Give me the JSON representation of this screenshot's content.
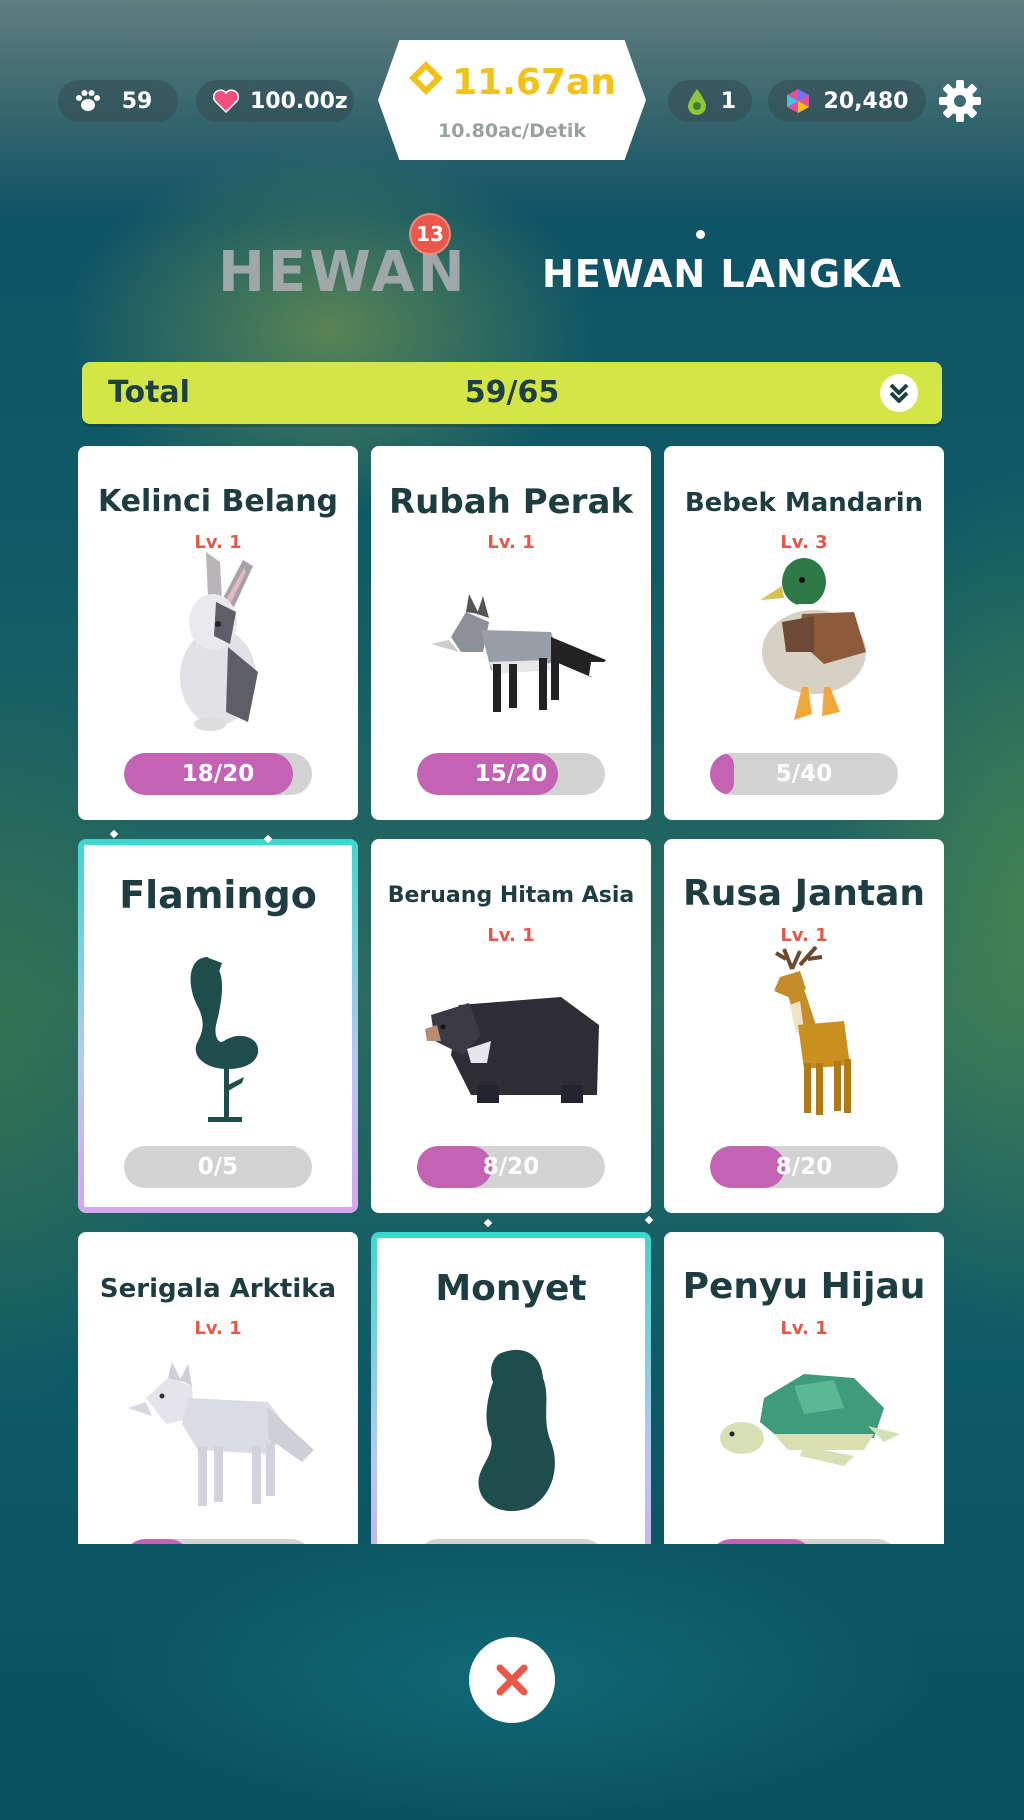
{
  "topbar": {
    "paws": "59",
    "hearts": "100.00z",
    "money": "11.67an",
    "rate": "10.80ac/Detik",
    "drops": "1",
    "gems": "20,480"
  },
  "tabs": {
    "hewan": "HEWAN",
    "hewan_badge": "13",
    "langka": "HEWAN LANGKA"
  },
  "total": {
    "label": "Total",
    "value": "59/65"
  },
  "cards": [
    {
      "name": "Kelinci Belang",
      "level": "Lv. 1",
      "progress": "18/20",
      "fraction": 0.9
    },
    {
      "name": "Rubah Perak",
      "level": "Lv. 1",
      "progress": "15/20",
      "fraction": 0.75
    },
    {
      "name": "Bebek Mandarin",
      "level": "Lv. 3",
      "progress": "5/40",
      "fraction": 0.125
    },
    {
      "name": "Flamingo",
      "level": "",
      "progress": "0/5",
      "fraction": 0
    },
    {
      "name": "Beruang Hitam Asia",
      "level": "Lv. 1",
      "progress": "8/20",
      "fraction": 0.4
    },
    {
      "name": "Rusa Jantan",
      "level": "Lv. 1",
      "progress": "8/20",
      "fraction": 0.4
    },
    {
      "name": "Serigala Arktika",
      "level": "Lv. 1",
      "progress": "",
      "fraction": 0.35
    },
    {
      "name": "Monyet",
      "level": "",
      "progress": "",
      "fraction": 0
    },
    {
      "name": "Penyu Hijau",
      "level": "Lv. 1",
      "progress": "",
      "fraction": 0.55
    }
  ],
  "colors": {
    "accent": "#d3e646",
    "progress": "#c462b4",
    "level": "#e05a4c",
    "money": "#f2c21b"
  },
  "icons": {
    "paws": "paw-icon",
    "hearts": "heart-icon",
    "money": "coin-icon",
    "drops": "drop-icon",
    "gems": "gem-icon",
    "settings": "gear-icon",
    "close": "close-icon",
    "expand": "double-chevron-down-icon"
  }
}
